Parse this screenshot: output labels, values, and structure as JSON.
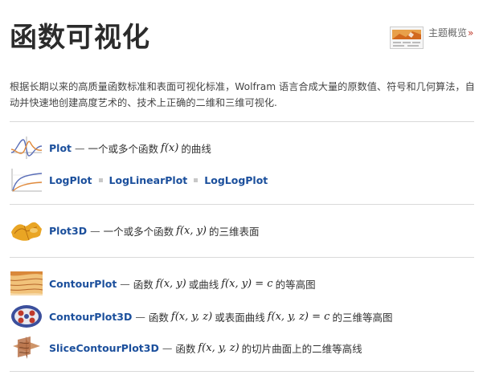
{
  "page": {
    "title": "函数可视化",
    "overview_label": "主题概览",
    "overview_arrow": "»",
    "description": "根据长期以来的高质量函数标准和表面可视化标准，Wolfram 语言合成大量的原数值、符号和几何算法，自动并快速地创建高度艺术的、技术上正确的二维和三维可视化."
  },
  "colors": {
    "link": "#1b4f9c",
    "accent": "#c0392b",
    "divider": "#d9d9d9"
  },
  "items": {
    "plot": {
      "name": "Plot",
      "dash": "—",
      "text1": "一个或多个函数",
      "math": "f(x)",
      "text2": "的曲线",
      "icon": "plot-curves-icon"
    },
    "logplot": {
      "name": "LogPlot",
      "icon": "log-plot-icon"
    },
    "loglinearplot": {
      "name": "LogLinearPlot"
    },
    "logloglot": {
      "name": "LogLogPlot"
    },
    "plot3d": {
      "name": "Plot3D",
      "dash": "—",
      "text1": "一个或多个函数",
      "math": "f(x, y)",
      "text2": "的三维表面",
      "icon": "surface-3d-icon"
    },
    "contourplot": {
      "name": "ContourPlot",
      "dash": "—",
      "text1": "函数",
      "math1": "f(x, y)",
      "text2": "或曲线",
      "math2": "f(x, y) = c",
      "text3": "的等高图",
      "icon": "contour-plot-icon"
    },
    "contourplot3d": {
      "name": "ContourPlot3D",
      "dash": "—",
      "text1": "函数",
      "math1": "f(x, y, z)",
      "text2": "或表面曲线",
      "math2": "f(x, y, z) = c",
      "text3": "的三维等高图",
      "icon": "contour-3d-icon"
    },
    "slicecontourplot3d": {
      "name": "SliceContourPlot3D",
      "dash": "—",
      "text1": "函数",
      "math": "f(x, y, z)",
      "text2": "的切片曲面上的二维等高线",
      "icon": "slice-contour-icon"
    }
  }
}
